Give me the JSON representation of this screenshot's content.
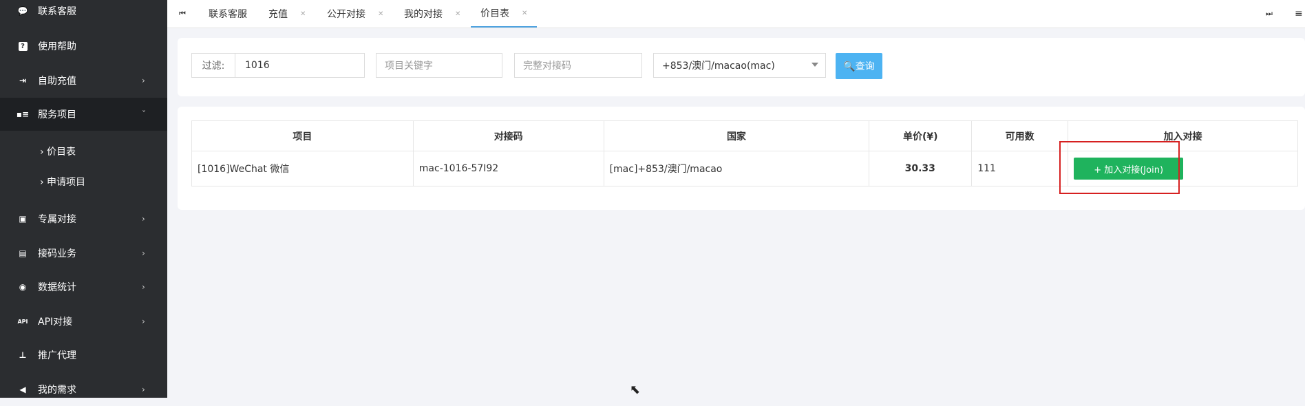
{
  "sidebar": {
    "items": [
      {
        "icon": "chat-bubble-icon",
        "label": "联系客服",
        "arrow": ""
      },
      {
        "icon": "help-icon",
        "label": "使用帮助",
        "arrow": ""
      },
      {
        "icon": "recharge-icon",
        "label": "自助充值",
        "arrow": "›"
      },
      {
        "icon": "service-icon",
        "label": "服务项目",
        "arrow": "ˇ"
      },
      {
        "icon": "dedicated-icon",
        "label": "专属对接",
        "arrow": "›"
      },
      {
        "icon": "sms-code-icon",
        "label": "接码业务",
        "arrow": "›"
      },
      {
        "icon": "stats-icon",
        "label": "数据统计",
        "arrow": "›"
      },
      {
        "icon": "api-icon",
        "label": "API对接",
        "arrow": "›"
      },
      {
        "icon": "org-chart-icon",
        "label": "推广代理",
        "arrow": ""
      },
      {
        "icon": "megaphone-icon",
        "label": "我的需求",
        "arrow": "›"
      }
    ],
    "subitems": [
      {
        "label": "› 价目表"
      },
      {
        "label": "› 申请项目"
      }
    ]
  },
  "tabs": [
    {
      "label": "联系客服",
      "closable": false
    },
    {
      "label": "充值",
      "closable": true
    },
    {
      "label": "公开对接",
      "closable": true
    },
    {
      "label": "我的对接",
      "closable": true
    },
    {
      "label": "价目表",
      "closable": true
    }
  ],
  "tabnav": {
    "first": "⏮",
    "last": "⏭",
    "menu": "≡"
  },
  "filter": {
    "label": "过滤:",
    "filter_value": "1016",
    "keyword_placeholder": "项目关键字",
    "code_placeholder": "完整对接码",
    "country_selected": "+853/澳门/macao(mac)",
    "query_label": "🔍查询"
  },
  "table": {
    "headers": [
      "项目",
      "对接码",
      "国家",
      "单价(¥)",
      "可用数",
      "加入对接"
    ],
    "rows": [
      {
        "project": "[1016]WeChat 微信",
        "code": "mac-1016-57I92",
        "country": "[mac]+853/澳门/macao",
        "price": "30.33",
        "available": "111",
        "join_label": "+ 加入对接(Join)"
      }
    ]
  },
  "colors": {
    "sidebar_bg": "#2b2d30",
    "accent": "#4fa3e0",
    "query_btn": "#4db3f2",
    "join_btn": "#1fb35d",
    "price": "#e01616",
    "highlight": "#d62020"
  }
}
